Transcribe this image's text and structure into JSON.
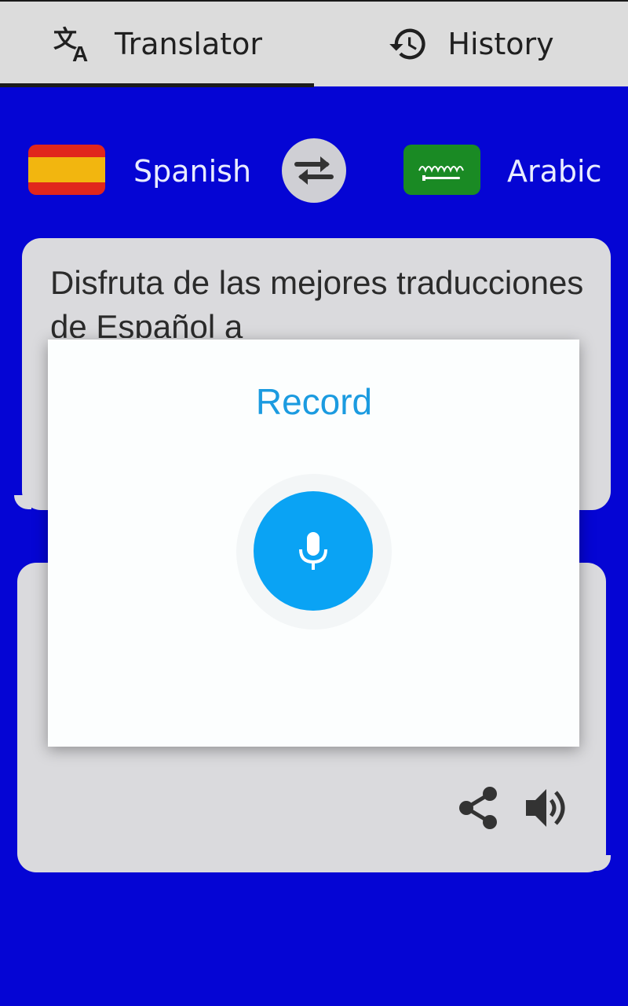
{
  "tabs": [
    {
      "label": "Translator",
      "icon": "translate-icon",
      "selected": true
    },
    {
      "label": "History",
      "icon": "history-icon",
      "selected": false
    }
  ],
  "languages": {
    "source": {
      "name": "Spanish",
      "flag": "spain-flag-icon"
    },
    "target": {
      "name": "Arabic",
      "flag": "saudi-arabia-flag-icon"
    },
    "swap_icon": "swap-arrows-icon"
  },
  "source_card": {
    "text": "Disfruta de las mejores traducciones de Español a"
  },
  "target_card": {
    "text": "…",
    "actions": [
      "share-icon",
      "speaker-icon"
    ]
  },
  "dialog": {
    "title": "Record",
    "button_icon": "microphone-icon"
  },
  "colors": {
    "background": "#0505d4",
    "tabbar": "#dcdcdc",
    "card": "#dadadd",
    "dialog_accent": "#1b9be0",
    "mic_button": "#0aa3f4",
    "flag_green": "#1a8a24"
  }
}
